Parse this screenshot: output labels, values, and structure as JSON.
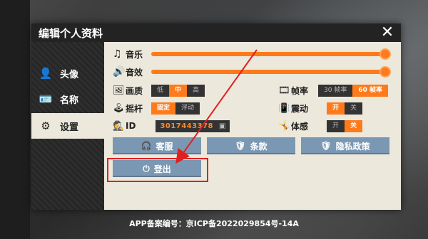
{
  "dialog": {
    "title": "编辑个人资料",
    "close_icon": "✕"
  },
  "sidebar": {
    "items": [
      {
        "label": "头像",
        "icon": "user-icon"
      },
      {
        "label": "名称",
        "icon": "id-card-icon"
      },
      {
        "label": "设置",
        "icon": "gear-icon",
        "active": true
      }
    ]
  },
  "settings": {
    "music": {
      "label": "音乐",
      "icon": "music-icon",
      "level": 1.0
    },
    "sound": {
      "label": "音效",
      "icon": "speaker-icon",
      "level": 1.0
    },
    "quality": {
      "label": "画质",
      "options": [
        "低",
        "中",
        "高"
      ],
      "selected": "中"
    },
    "framerate": {
      "label": "帧率",
      "options": [
        "30 帧率",
        "60 帧率"
      ],
      "selected": "60 帧率"
    },
    "joystick": {
      "label": "摇杆",
      "options": [
        "固定",
        "浮动"
      ],
      "selected": "固定"
    },
    "vibration": {
      "label": "震动",
      "options": [
        "开",
        "关"
      ],
      "selected": "开"
    },
    "id": {
      "label": "ID",
      "value": "3017443378"
    },
    "motion": {
      "label": "体感",
      "options": [
        "开",
        "关"
      ],
      "selected": "关"
    }
  },
  "buttons": {
    "service": "客服",
    "terms": "条款",
    "privacy": "隐私政策",
    "logout": "登出"
  },
  "footer": {
    "text": "APP备案编号：京ICP备2022029854号-14A"
  },
  "colors": {
    "accent": "#ff7a1a",
    "button": "#7a98b3",
    "highlight": "#e02020"
  }
}
